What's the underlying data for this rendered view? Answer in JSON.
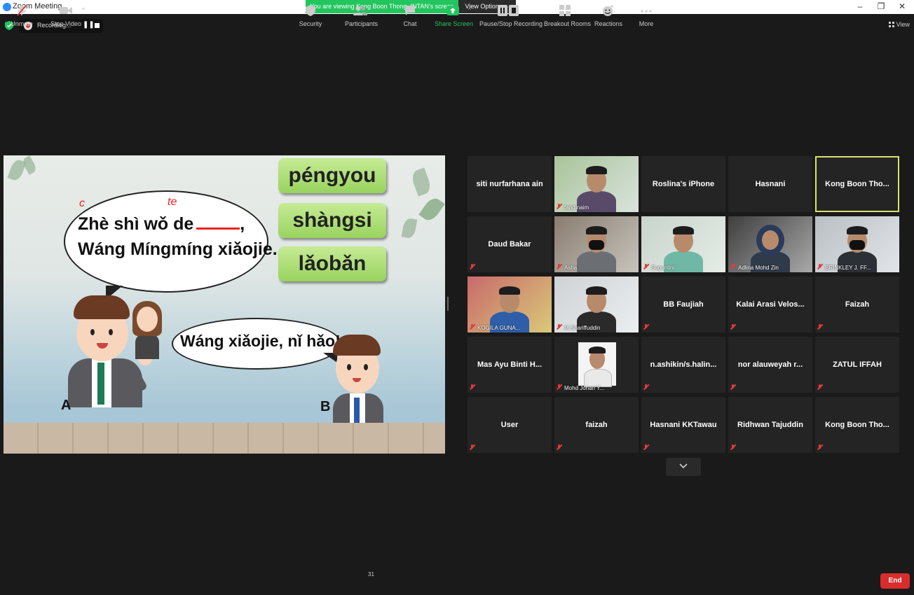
{
  "window": {
    "title": "Zoom Meeting",
    "banner": "You are viewing Kong Boon Thong. INTAN's screen",
    "view_options": "View Options",
    "minimize": "–",
    "maximize": "❐",
    "close": "✕"
  },
  "recording": {
    "label": "Recording...",
    "pause": "❚❚"
  },
  "view_label": "View",
  "slide": {
    "bubble1_line1": "Zhè shì wǒ de",
    "bubble1_comma": ",",
    "bubble1_line2": "Wáng Míngmíng xiǎojie.",
    "bubble2": "Wáng xiǎojie, nǐ hǎo!",
    "cards": [
      "péngyou",
      "shàngsi",
      "lǎobǎn"
    ],
    "label_a": "A",
    "label_b": "B",
    "annotation_c": "c",
    "annotation_te": "te"
  },
  "participants": [
    {
      "name": "siti nurfarhana ain",
      "video": false,
      "muted": false
    },
    {
      "name": "farid naim",
      "video": true,
      "muted": true
    },
    {
      "name": "Roslina's iPhone",
      "video": false,
      "muted": false
    },
    {
      "name": "Hasnani",
      "video": false,
      "muted": false
    },
    {
      "name": "Kong Boon Tho...",
      "video": false,
      "muted": false,
      "active": true
    },
    {
      "name": "Daud Bakar",
      "video": false,
      "muted": true
    },
    {
      "name": "Asha",
      "video": true,
      "muted": true
    },
    {
      "name": "Suguntini",
      "video": true,
      "muted": true
    },
    {
      "name": "Adlina Mohd Zin",
      "video": true,
      "muted": true
    },
    {
      "name": "BRINKLEY J. FF...",
      "video": true,
      "muted": true
    },
    {
      "name": "KOGILA GUNA...",
      "video": true,
      "muted": true
    },
    {
      "name": "M.Shariffuddin",
      "video": true,
      "muted": true
    },
    {
      "name": "BB Faujiah",
      "video": false,
      "muted": true
    },
    {
      "name": "Kalai Arasi Velos...",
      "video": false,
      "muted": true
    },
    {
      "name": "Faizah",
      "video": false,
      "muted": true
    },
    {
      "name": "Mas Ayu Binti H...",
      "video": false,
      "muted": true
    },
    {
      "name": "Mohd Johari Y...",
      "video": true,
      "muted": true
    },
    {
      "name": "n.ashikin/s.halin...",
      "video": false,
      "muted": true
    },
    {
      "name": "nor alauweyah r...",
      "video": false,
      "muted": true
    },
    {
      "name": "ZATUL IFFAH",
      "video": false,
      "muted": true
    },
    {
      "name": "User",
      "video": false,
      "muted": true
    },
    {
      "name": "faizah",
      "video": false,
      "muted": true
    },
    {
      "name": "Hasnani KKTawau",
      "video": false,
      "muted": true
    },
    {
      "name": "Ridhwan Tajuddin",
      "video": false,
      "muted": true
    },
    {
      "name": "Kong Boon Tho...",
      "video": false,
      "muted": true
    }
  ],
  "toolbar": {
    "unmute": "Unmute",
    "stop_video": "Stop Video",
    "security": "Security",
    "participants": "Participants",
    "participants_count": "31",
    "chat": "Chat",
    "share_screen": "Share Screen",
    "pause_stop_recording": "Pause/Stop Recording",
    "breakout_rooms": "Breakout Rooms",
    "reactions": "Reactions",
    "more": "More",
    "end": "End"
  },
  "colors": {
    "banner_green": "#22c55e",
    "active_speaker": "#d6e26a",
    "end_red": "#d92c2c",
    "muted_red": "#e23b3b"
  }
}
